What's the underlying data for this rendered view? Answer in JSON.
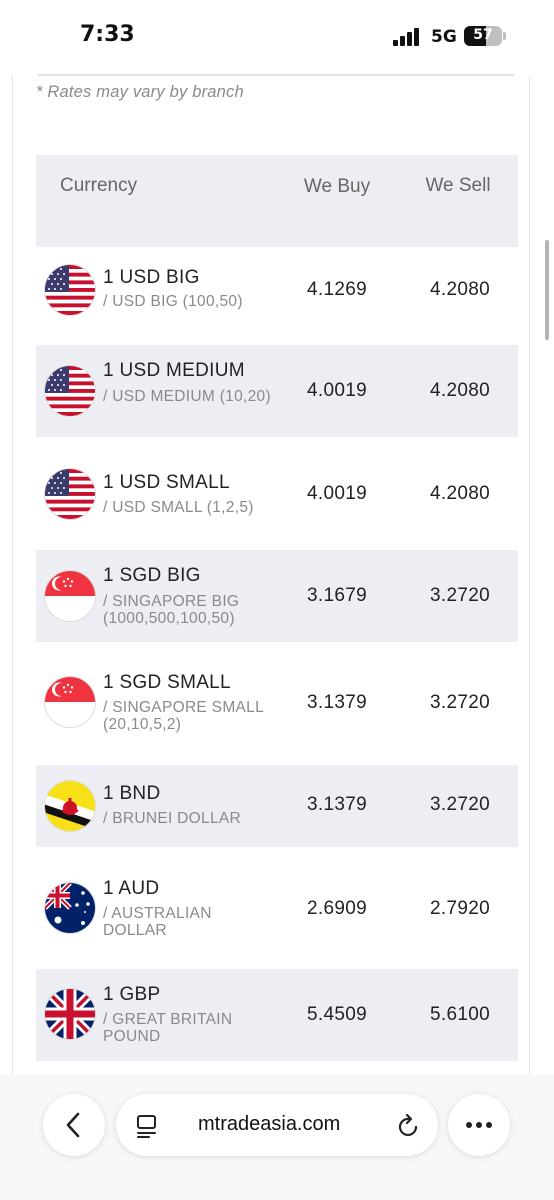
{
  "status": {
    "time": "7:33",
    "network": "5G",
    "battery": "57",
    "battery_level": 0.57
  },
  "note": "* Rates may vary by branch",
  "table": {
    "headers": {
      "currency": "Currency",
      "buy": "We Buy",
      "sell": "We Sell"
    },
    "rows": [
      {
        "flag": "us-flag-icon",
        "title": "1 USD BIG",
        "subtitle": "/ USD BIG (100,50)",
        "buy": "4.1269",
        "sell": "4.2080"
      },
      {
        "flag": "us-flag-icon",
        "title": "1 USD MEDIUM",
        "subtitle": "/ USD MEDIUM (10,20)",
        "buy": "4.0019",
        "sell": "4.2080"
      },
      {
        "flag": "us-flag-icon",
        "title": "1 USD SMALL",
        "subtitle": "/ USD SMALL (1,2,5)",
        "buy": "4.0019",
        "sell": "4.2080"
      },
      {
        "flag": "singapore-flag-icon",
        "title": "1 SGD BIG",
        "subtitle": "/ SINGAPORE BIG (1000,500,100,50)",
        "buy": "3.1679",
        "sell": "3.2720"
      },
      {
        "flag": "singapore-flag-icon",
        "title": "1 SGD SMALL",
        "subtitle": "/ SINGAPORE SMALL (20,10,5,2)",
        "buy": "3.1379",
        "sell": "3.2720"
      },
      {
        "flag": "brunei-flag-icon",
        "title": "1 BND",
        "subtitle": "/ BRUNEI DOLLAR",
        "buy": "3.1379",
        "sell": "3.2720"
      },
      {
        "flag": "australia-flag-icon",
        "title": "1 AUD",
        "subtitle": "/ AUSTRALIAN DOLLAR",
        "buy": "2.6909",
        "sell": "2.7920"
      },
      {
        "flag": "uk-flag-icon",
        "title": "1 GBP",
        "subtitle": "/ GREAT BRITAIN POUND",
        "buy": "5.4509",
        "sell": "5.6100"
      }
    ]
  },
  "browser": {
    "url": "mtradeasia.com",
    "icons": {
      "back": "chevron-left-icon",
      "tabs": "page-icon",
      "reload": "reload-icon",
      "more": "more-icon"
    }
  },
  "colors": {
    "row_shade": "#eceef3",
    "muted_text": "#8a8a8a"
  }
}
